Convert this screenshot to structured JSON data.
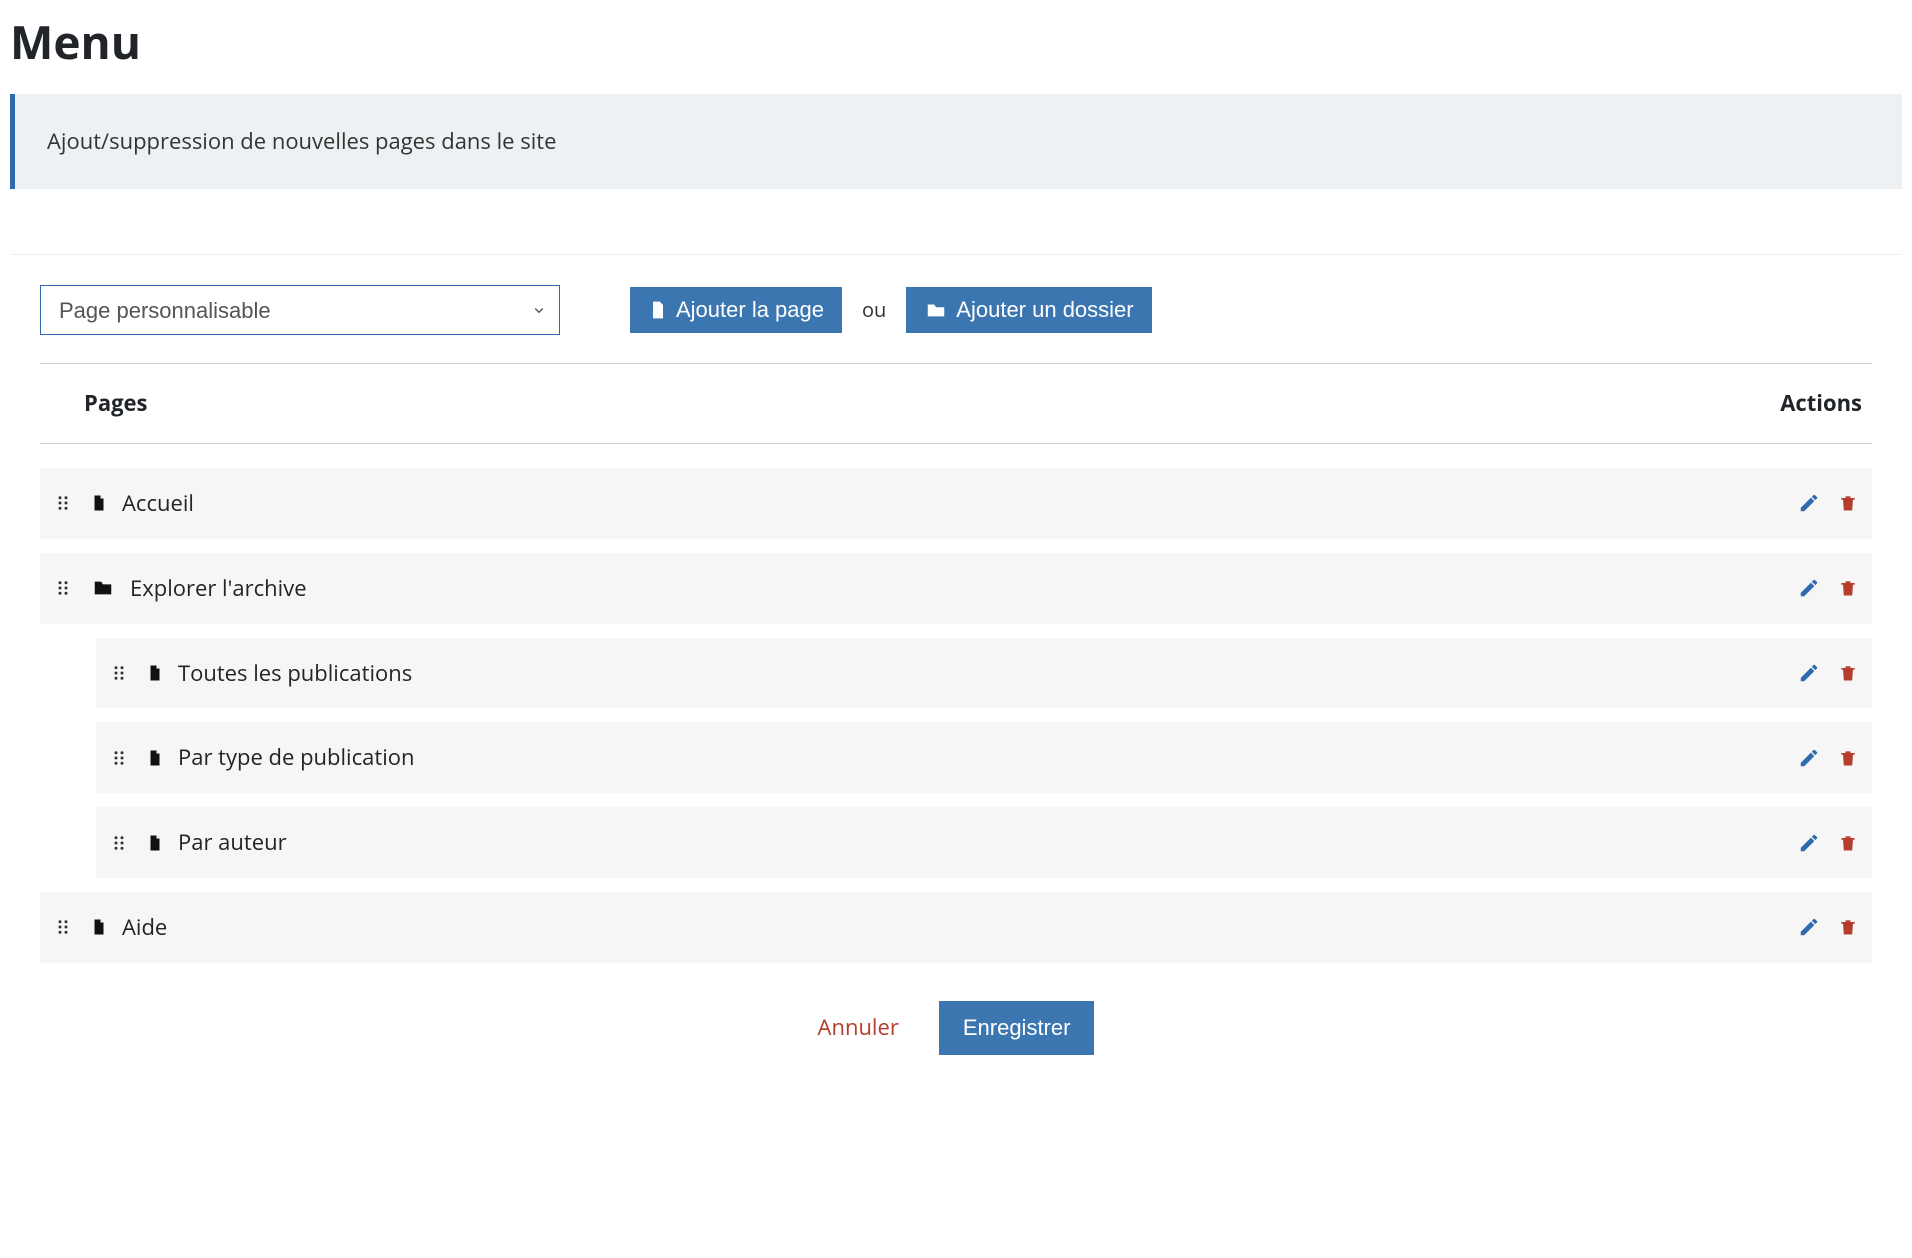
{
  "page": {
    "title": "Menu",
    "banner": "Ajout/suppression de nouvelles pages dans le site"
  },
  "toolbar": {
    "page_type_selected": "Page personnalisable",
    "add_page_label": "Ajouter la page",
    "or_label": "ou",
    "add_folder_label": "Ajouter un dossier"
  },
  "table": {
    "col_pages": "Pages",
    "col_actions": "Actions"
  },
  "rows": [
    {
      "type": "file",
      "level": 0,
      "label": "Accueil"
    },
    {
      "type": "folder",
      "level": 0,
      "label": "Explorer l'archive"
    },
    {
      "type": "file",
      "level": 1,
      "label": "Toutes les publications"
    },
    {
      "type": "file",
      "level": 1,
      "label": "Par type de publication"
    },
    {
      "type": "file",
      "level": 1,
      "label": "Par auteur"
    },
    {
      "type": "file",
      "level": 0,
      "label": "Aide"
    }
  ],
  "footer": {
    "cancel_label": "Annuler",
    "save_label": "Enregistrer"
  },
  "icons": {
    "drag": "drag-handle-icon",
    "file": "file-icon",
    "folder": "folder-icon",
    "edit": "pencil-icon",
    "delete": "trash-icon",
    "chevron": "chevron-down-icon"
  },
  "colors": {
    "primary": "#3c76b1",
    "accent": "#2f6aae",
    "danger": "#b53d2c",
    "banner_bg": "#eef1f3",
    "row_bg": "#f6f6f6"
  }
}
